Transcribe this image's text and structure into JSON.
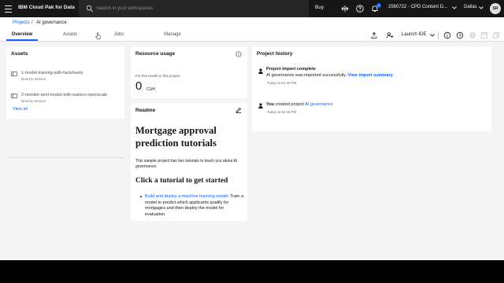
{
  "header": {
    "brand": "IBM Cloud Pak for Data",
    "search_placeholder": "Search in your workspaces",
    "buy": "Buy",
    "notification_count": "4",
    "account": "2560722 - CPD Content D...",
    "region": "Dallas",
    "avatar_initials": "SR"
  },
  "breadcrumb": {
    "parent": "Projects",
    "separator": "/",
    "current": "AI governance"
  },
  "tabs": [
    {
      "label": "Overview",
      "active": true
    },
    {
      "label": "Assets",
      "active": false
    },
    {
      "label": "Jobs",
      "active": false
    },
    {
      "label": "Manage",
      "active": false
    }
  ],
  "toolbar": {
    "launch_ide": "Launch IDE"
  },
  "assets": {
    "title": "Assets",
    "items": [
      {
        "name": "1-model-training-with-factsheets",
        "meta": "Now by Service"
      },
      {
        "name": "2-monitor-wml-model-with-watson-openscale",
        "meta": "Now by Service"
      }
    ],
    "view_all": "View all"
  },
  "resource_usage": {
    "title": "Resource usage",
    "caption": "For this month in this project",
    "value": "0",
    "unit": "CUH"
  },
  "readme": {
    "title": "Readme",
    "heading": "Mortgage approval prediction tutorials",
    "intro": "This sample project has two tutorials to teach you about AI governance.",
    "subheading": "Click a tutorial to get started",
    "list_link": "Build and deploy a machine learning model",
    "list_text": ": Train a model to predict which applicants qualify for mortgages and then deploy the model for evaluation."
  },
  "history": {
    "title": "Project history",
    "entries": [
      {
        "title": "Project import complete",
        "text": "AI governance was imported successfully.",
        "link": "View import summary.",
        "time": "Today at 02:46 PM"
      },
      {
        "prefix": "You",
        "text": " created project ",
        "link": "AI governance",
        "time": "Today at 02:46 PM"
      }
    ]
  },
  "colors": {
    "header_bg": "#161616",
    "accent": "#0f62fe",
    "page_bg": "#f4f4f4"
  }
}
